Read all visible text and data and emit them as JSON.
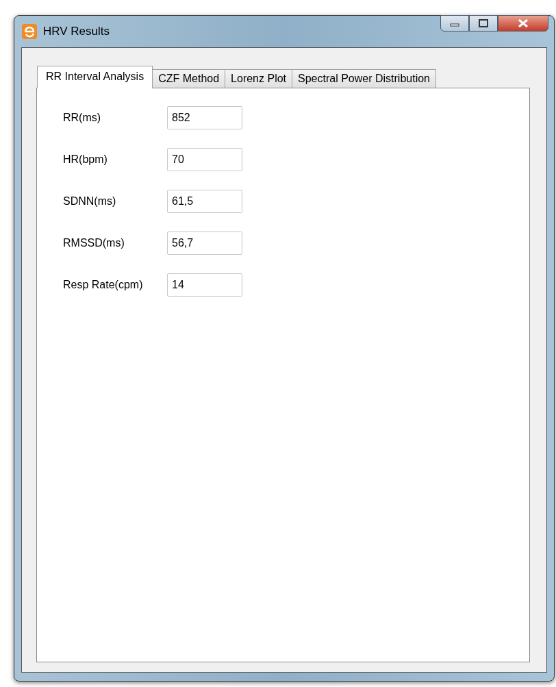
{
  "window": {
    "title": "HRV Results"
  },
  "tabs": [
    {
      "label": "RR Interval Analysis",
      "selected": true
    },
    {
      "label": "CZF Method",
      "selected": false
    },
    {
      "label": "Lorenz Plot",
      "selected": false
    },
    {
      "label": "Spectral Power Distribution",
      "selected": false
    }
  ],
  "fields": [
    {
      "label": "RR(ms)",
      "value": "852"
    },
    {
      "label": "HR(bpm)",
      "value": "70"
    },
    {
      "label": "SDNN(ms)",
      "value": "61,5"
    },
    {
      "label": "RMSSD(ms)",
      "value": "56,7"
    },
    {
      "label": "Resp Rate(cpm)",
      "value": "14"
    }
  ]
}
